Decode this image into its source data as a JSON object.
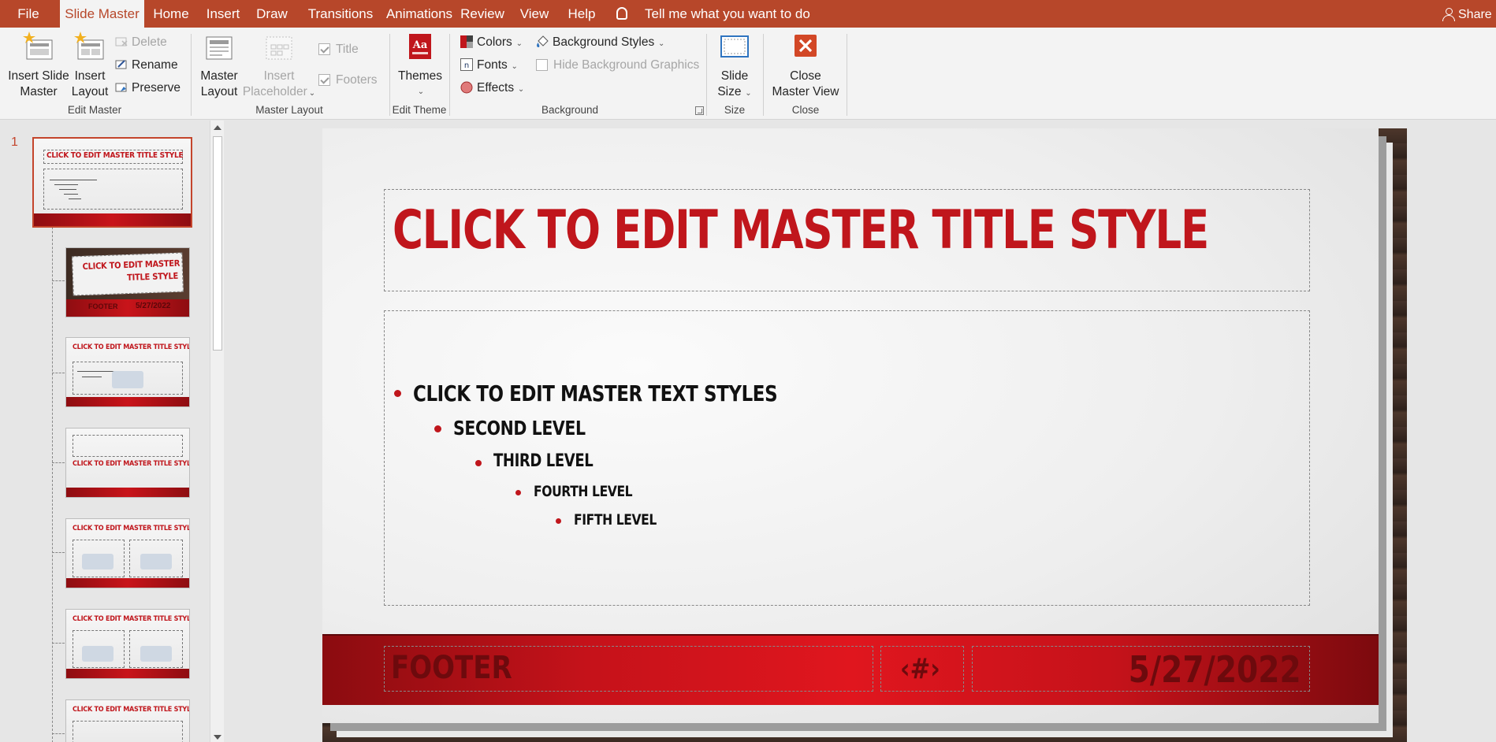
{
  "menu": {
    "tabs": [
      "File",
      "Slide Master",
      "Home",
      "Insert",
      "Draw",
      "Transitions",
      "Animations",
      "Review",
      "View",
      "Help"
    ],
    "active_tab": "Slide Master",
    "tell_me": "Tell me what you want to do",
    "share": "Share"
  },
  "ribbon": {
    "edit_master": {
      "insert_slide_master_l1": "Insert Slide",
      "insert_slide_master_l2": "Master",
      "insert_layout_l1": "Insert",
      "insert_layout_l2": "Layout",
      "delete": "Delete",
      "rename": "Rename",
      "preserve": "Preserve",
      "label": "Edit Master"
    },
    "master_layout": {
      "master_layout_l1": "Master",
      "master_layout_l2": "Layout",
      "insert_placeholder_l1": "Insert",
      "insert_placeholder_l2": "Placeholder",
      "title": "Title",
      "footers": "Footers",
      "label": "Master Layout"
    },
    "edit_theme": {
      "themes": "Themes",
      "label": "Edit Theme"
    },
    "background": {
      "colors": "Colors",
      "fonts": "Fonts",
      "effects": "Effects",
      "background_styles": "Background Styles",
      "hide_background_graphics": "Hide Background Graphics",
      "label": "Background"
    },
    "size": {
      "slide_size_l1": "Slide",
      "slide_size_l2": "Size",
      "label": "Size"
    },
    "close": {
      "close_master_view_l1": "Close",
      "close_master_view_l2": "Master View",
      "label": "Close"
    }
  },
  "thumbnails": {
    "master_number": "1",
    "master_title": "CLICK TO EDIT MASTER TITLE STYLE",
    "layout1_title_l1": "CLICK TO EDIT MASTER",
    "layout1_title_l2": "TITLE STYLE",
    "layout1_footer": "FOOTER",
    "layout1_date": "5/27/2022",
    "layout_title": "CLICK TO EDIT MASTER TITLE STYLE"
  },
  "slide": {
    "title": "CLICK TO EDIT MASTER TITLE STYLE",
    "levels": [
      "CLICK TO EDIT MASTER TEXT STYLES",
      "SECOND LEVEL",
      "THIRD LEVEL",
      "FOURTH LEVEL",
      "FIFTH LEVEL"
    ],
    "footer": "FOOTER",
    "slide_number": "‹#›",
    "date": "5/27/2022"
  },
  "colors": {
    "accent": "#b7472a",
    "title_red": "#c0161c",
    "footer_red": "#c5121a"
  }
}
